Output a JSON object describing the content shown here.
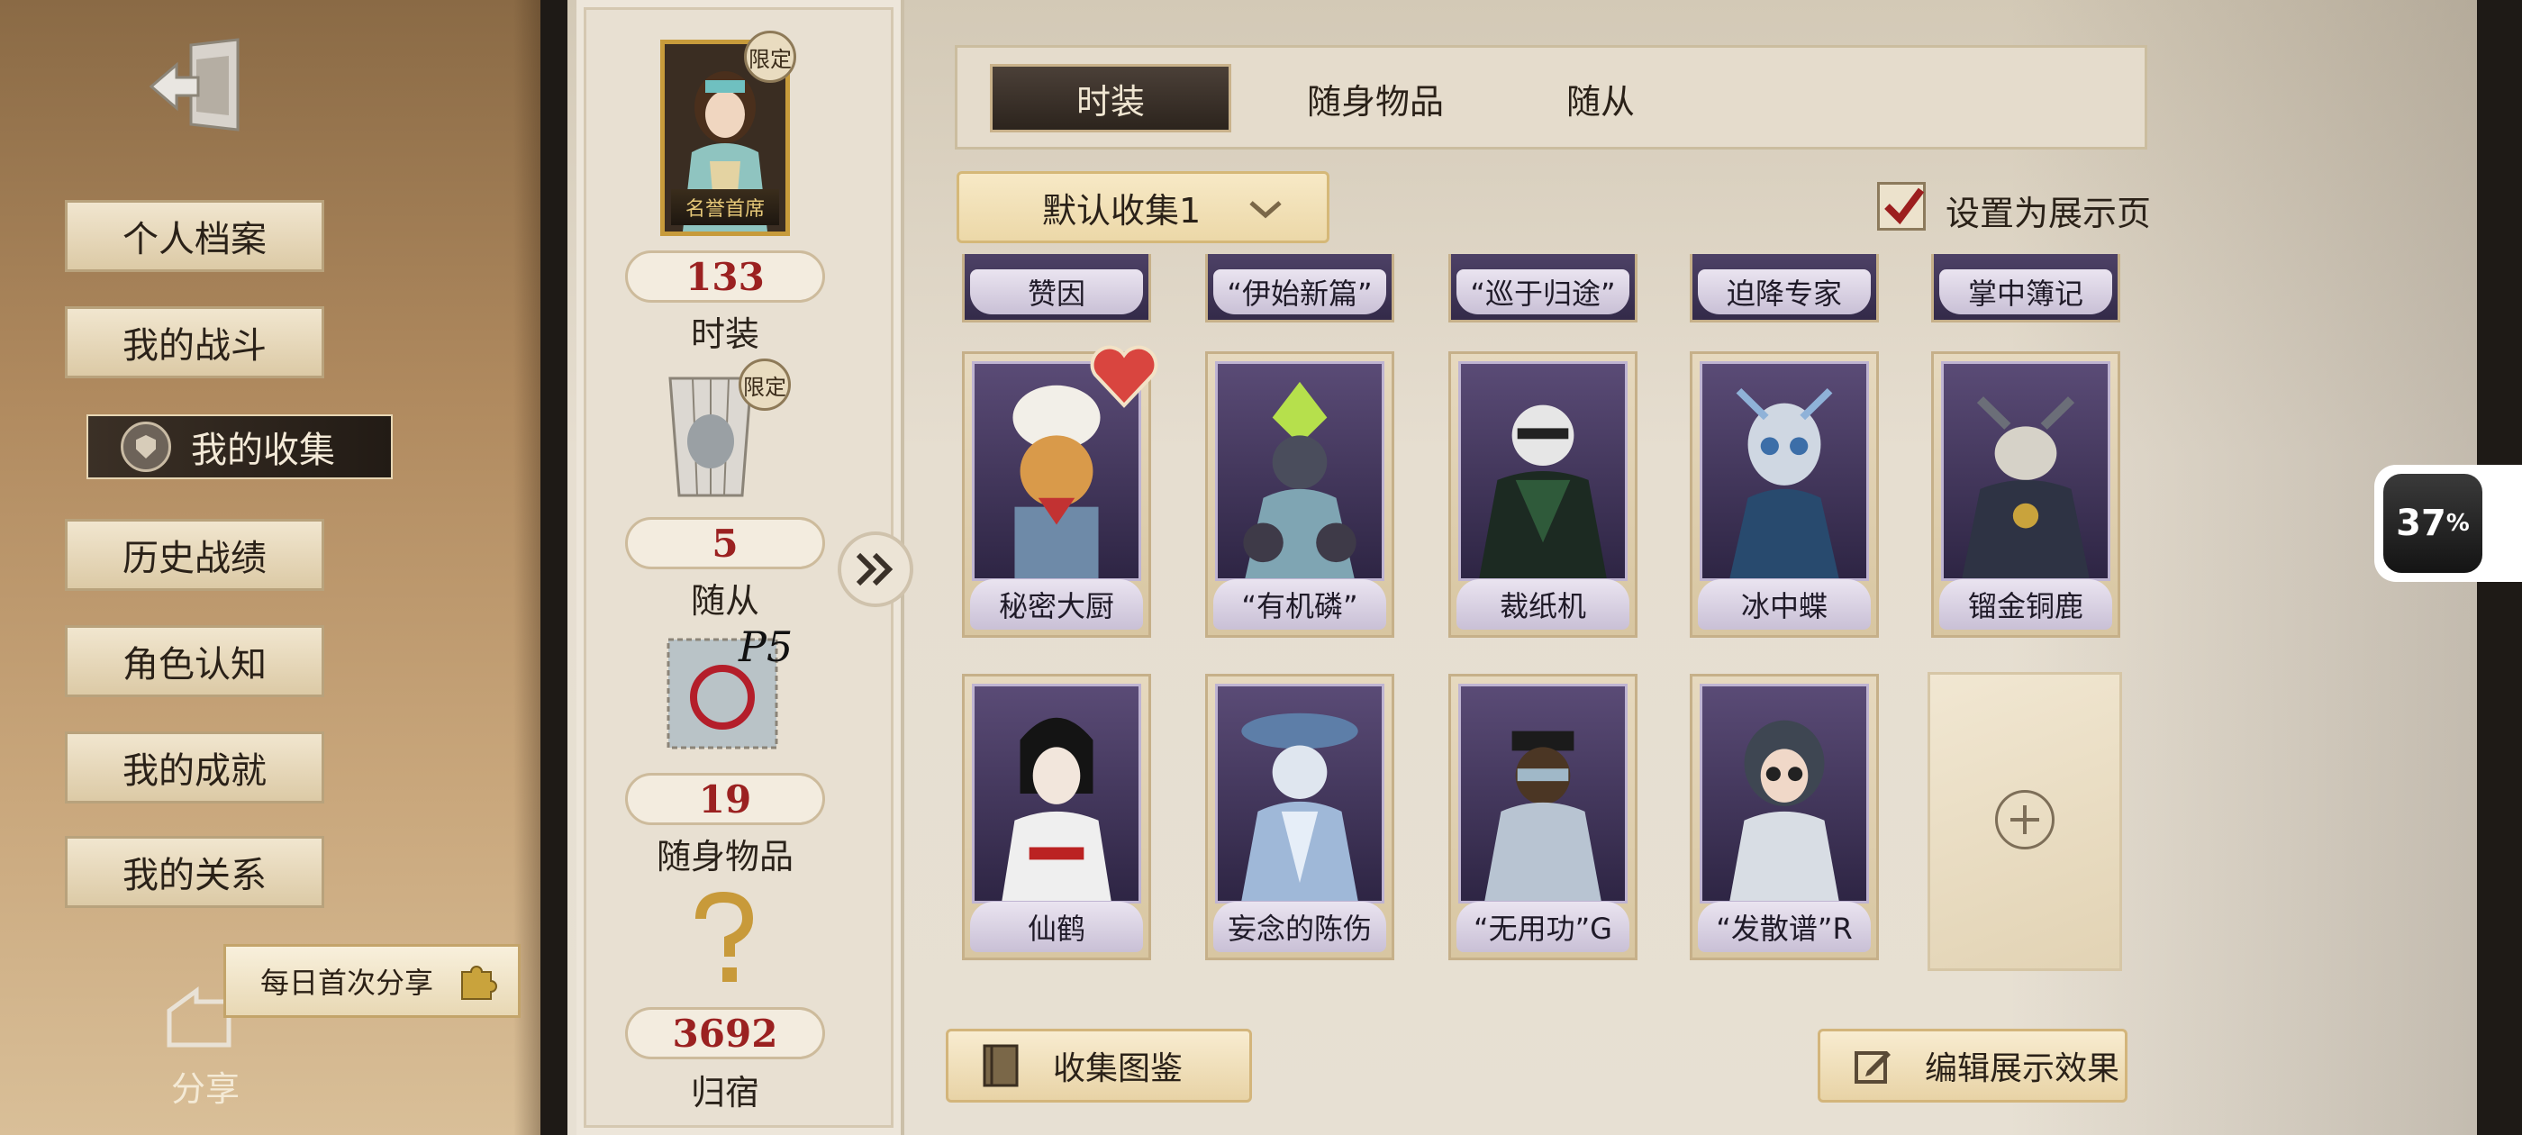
{
  "sidebar": {
    "items": [
      {
        "label": "个人档案"
      },
      {
        "label": "我的战斗"
      },
      {
        "label": "我的收集"
      },
      {
        "label": "历史战绩"
      },
      {
        "label": "角色认知"
      },
      {
        "label": "我的成就"
      },
      {
        "label": "我的关系"
      }
    ],
    "share_banner": "每日首次分享",
    "share_label": "分享"
  },
  "stats": {
    "portrait_caption": "名誉首席",
    "limited_tag": "限定",
    "costumes_count": "133",
    "costumes_label": "时装",
    "followers_count": "5",
    "followers_label": "随从",
    "items_count": "19",
    "items_label": "随身物品",
    "destination_count": "3692",
    "destination_label": "归宿"
  },
  "tabs": [
    {
      "label": "时装"
    },
    {
      "label": "随身物品"
    },
    {
      "label": "随从"
    }
  ],
  "dropdown": {
    "value": "默认收集1"
  },
  "showcase": {
    "label": "设置为展示页",
    "checked": true
  },
  "partial_row": [
    "赞因",
    "“伊始新篇”",
    "“巡于归途”",
    "迫降专家",
    "掌中簿记"
  ],
  "row1": [
    "秘密大厨",
    "“有机磷”",
    "裁纸机",
    "冰中蝶",
    "镏金铜鹿"
  ],
  "row2": [
    "仙鹤",
    "妄念的陈伤",
    "“无用功”G",
    "“发散谱”R"
  ],
  "buttons": {
    "collection_guide": "收集图鉴",
    "edit_display": "编辑展示效果"
  },
  "overlay": {
    "percent": "37",
    "unit": "%"
  },
  "colors": {
    "accent_red": "#9b2121",
    "card_purple": "#4d4166",
    "paper": "#e6ded0",
    "sidebar_brown": "#b08a5f"
  }
}
